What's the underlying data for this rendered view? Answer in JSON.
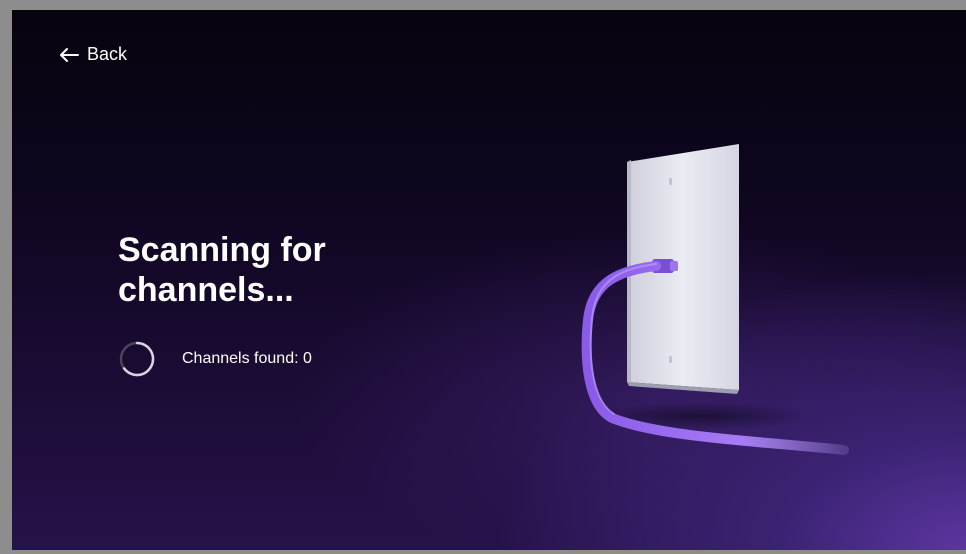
{
  "nav": {
    "back_label": "Back"
  },
  "main": {
    "title": "Scanning for channels...",
    "status_label": "Channels found: 0"
  },
  "icons": {
    "back": "arrow-left-icon",
    "spinner": "loading-spinner-icon",
    "illustration": "wall-plate-coax-cable-illustration"
  },
  "colors": {
    "background_top": "#07030d",
    "background_bottom_right": "#5b36a0",
    "text": "#ffffff",
    "cable": "#9a6cf0",
    "wall_plate": "#e4e4ee"
  }
}
